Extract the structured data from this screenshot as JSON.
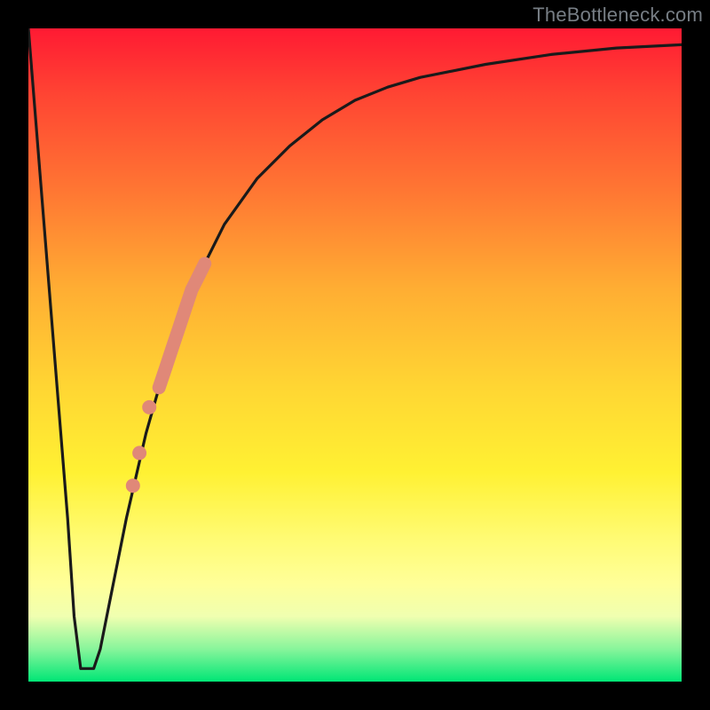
{
  "watermark": "TheBottleneck.com",
  "colors": {
    "curve_stroke": "#1a1a1a",
    "dot_fill": "#e08878",
    "band_stroke": "#e08878"
  },
  "chart_data": {
    "type": "line",
    "title": "",
    "xlabel": "",
    "ylabel": "",
    "xlim": [
      0,
      100
    ],
    "ylim": [
      0,
      100
    ],
    "series": [
      {
        "name": "bottleneck-curve",
        "x": [
          0,
          2,
          4,
          6,
          7,
          8,
          9,
          10,
          11,
          12,
          15,
          18,
          20,
          22,
          25,
          30,
          35,
          40,
          45,
          50,
          55,
          60,
          70,
          80,
          90,
          100
        ],
        "values": [
          100,
          75,
          50,
          25,
          10,
          2,
          2,
          2,
          5,
          10,
          25,
          38,
          45,
          52,
          60,
          70,
          77,
          82,
          86,
          89,
          91,
          92.5,
          94.5,
          96,
          97,
          97.5
        ]
      }
    ],
    "markers": {
      "name": "highlighted-points",
      "x": [
        16,
        17,
        18.5,
        20,
        21,
        22,
        23,
        24,
        25,
        26,
        27
      ],
      "values": [
        30,
        35,
        42,
        45,
        48,
        51,
        54,
        57,
        60,
        62,
        64
      ]
    }
  }
}
